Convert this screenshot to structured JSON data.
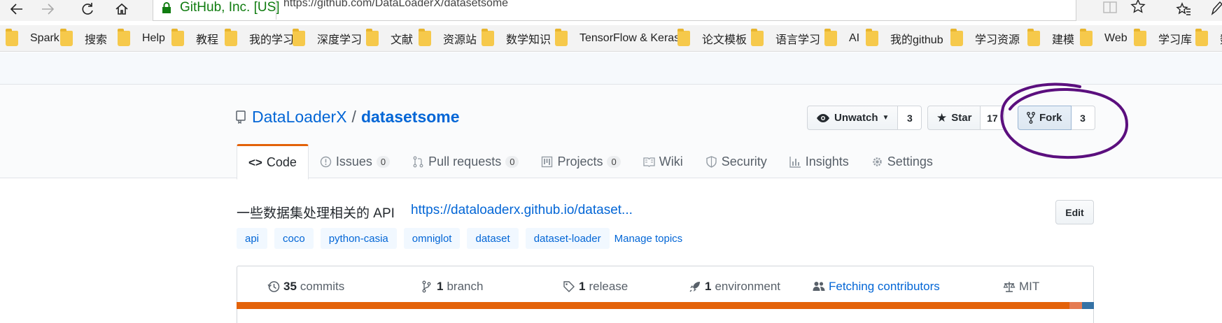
{
  "browser": {
    "site_identity": "GitHub, Inc. [US]",
    "url": "https://github.com/DataLoaderX/datasetsome",
    "bookmarks": [
      "Spark",
      "搜索",
      "Help",
      "教程",
      "我的学习",
      "深度学习",
      "文献",
      "资源站",
      "数学知识",
      "TensorFlow & Keras",
      "论文模板",
      "语言学习",
      "AI",
      "我的github",
      "学习资源",
      "建模",
      "Web",
      "学习库",
      "数"
    ]
  },
  "repo": {
    "owner": "DataLoaderX",
    "separator": "/",
    "name": "datasetsome",
    "unwatch_label": "Unwatch",
    "watch_count": "3",
    "star_label": "Star",
    "star_count": "17",
    "fork_label": "Fork",
    "fork_count": "3"
  },
  "tabs": [
    {
      "label": "Code"
    },
    {
      "label": "Issues",
      "count": "0"
    },
    {
      "label": "Pull requests",
      "count": "0"
    },
    {
      "label": "Projects",
      "count": "0"
    },
    {
      "label": "Wiki"
    },
    {
      "label": "Security"
    },
    {
      "label": "Insights"
    },
    {
      "label": "Settings"
    }
  ],
  "about": {
    "description": "一些数据集处理相关的 API",
    "homepage": "https://dataloaderx.github.io/dataset...",
    "edit_label": "Edit",
    "topics": [
      "api",
      "coco",
      "python-casia",
      "omniglot",
      "dataset",
      "dataset-loader"
    ],
    "manage_topics": "Manage topics"
  },
  "numbers": {
    "commits_count": "35",
    "commits_label": "commits",
    "branches_count": "1",
    "branches_label": "branch",
    "releases_count": "1",
    "releases_label": "release",
    "env_count": "1",
    "env_label": "environment",
    "contributors_label": "Fetching contributors",
    "license_label": "MIT"
  },
  "colors": {
    "link": "#0366d6",
    "selected_tab_accent": "#e36209",
    "annotation_circle": "#5b0f7e",
    "language_bar": [
      "#e36209",
      "#e57b52",
      "#3572a5"
    ]
  }
}
